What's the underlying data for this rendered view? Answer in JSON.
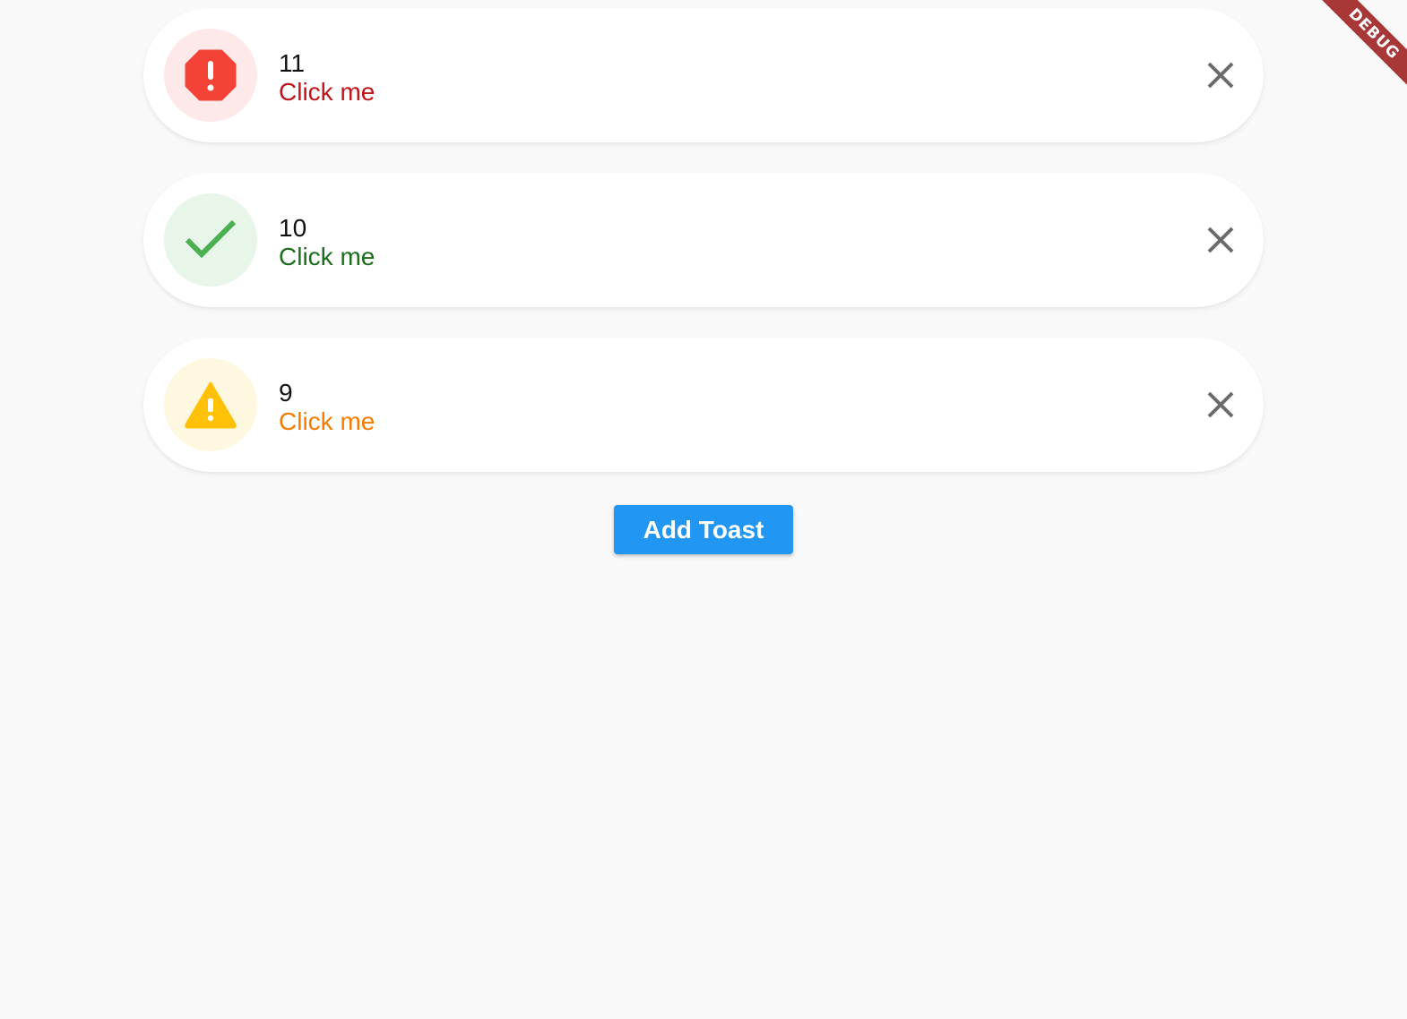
{
  "toasts": [
    {
      "count": "11",
      "action_label": "Click me",
      "icon": "error-octagon-icon",
      "accent_color": "#f44336",
      "text_color": "#c0151a",
      "circle_color": "#fde8ea"
    },
    {
      "count": "10",
      "action_label": "Click me",
      "icon": "check-icon",
      "accent_color": "#4caf50",
      "text_color": "#1b6e1b",
      "circle_color": "#e8f5e9"
    },
    {
      "count": "9",
      "action_label": "Click me",
      "icon": "warning-triangle-icon",
      "accent_color": "#ffc107",
      "text_color": "#f57c00",
      "circle_color": "#fff8e1"
    }
  ],
  "close_icon": "close-icon",
  "add_button": {
    "label": "Add Toast",
    "color": "#2196f3"
  },
  "debug_banner": {
    "label": "DEBUG",
    "color": "#a83838"
  }
}
